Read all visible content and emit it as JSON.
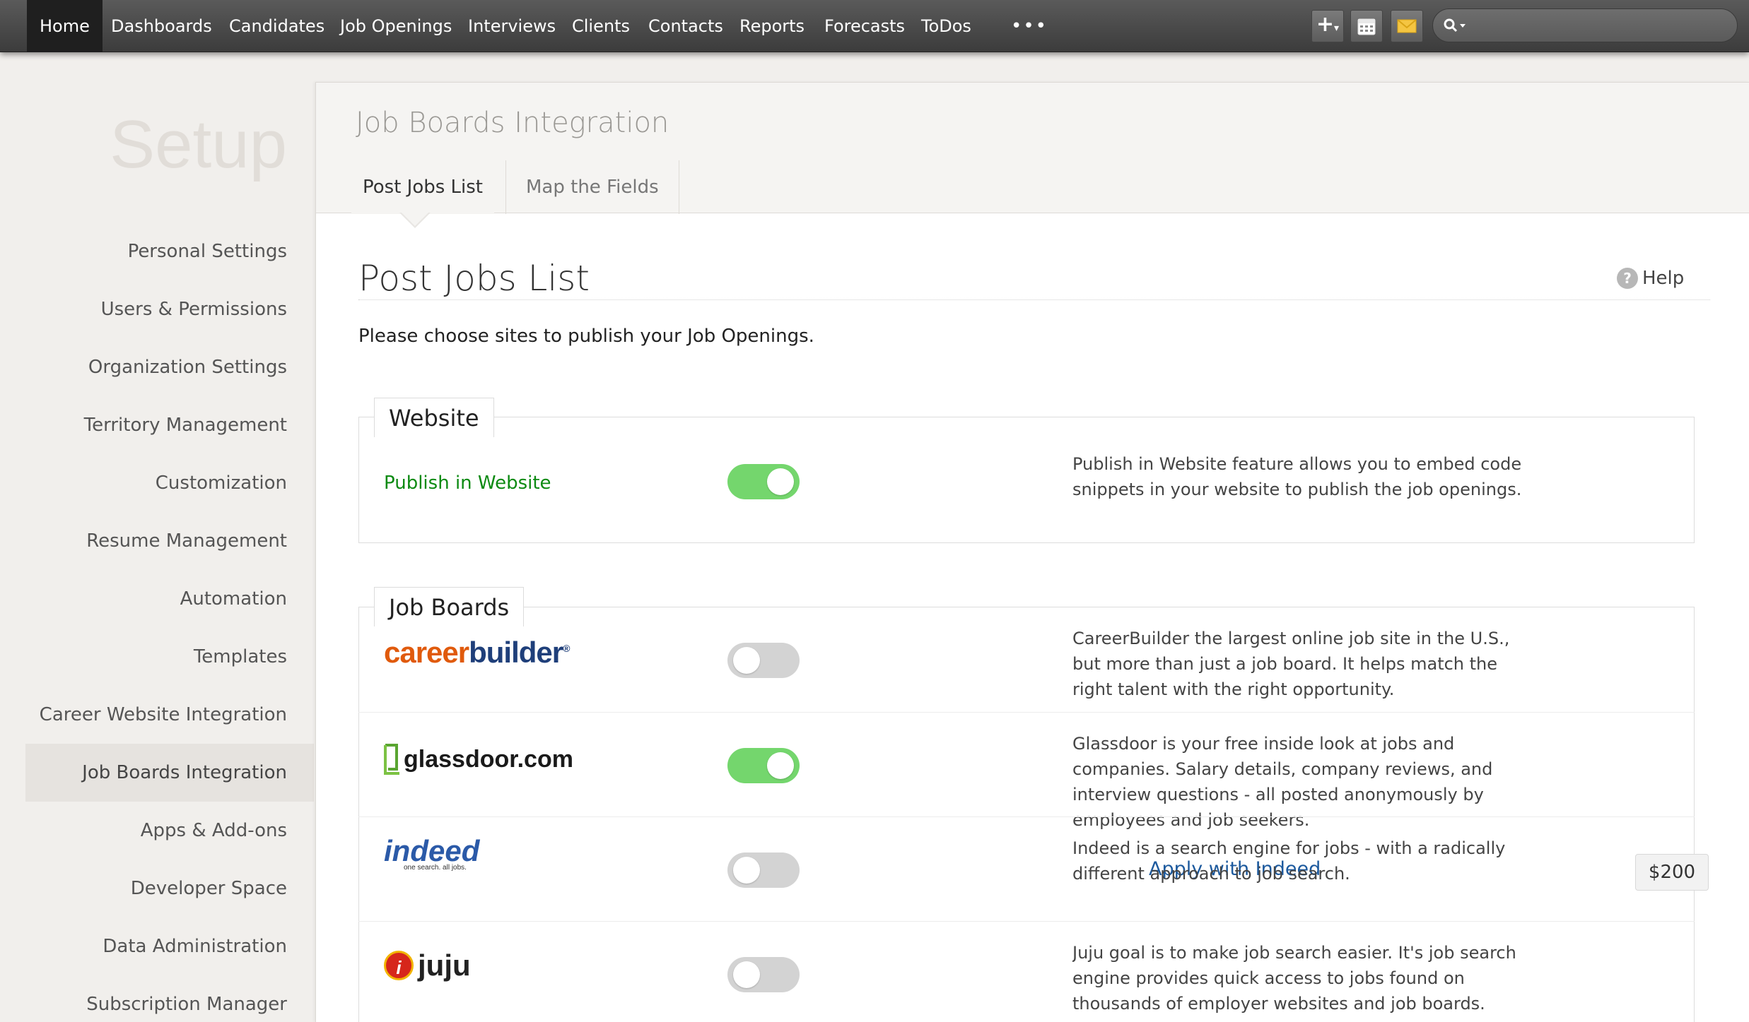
{
  "nav": {
    "items": [
      "Home",
      "Dashboards",
      "Candidates",
      "Job Openings",
      "Interviews",
      "Clients",
      "Contacts",
      "Reports",
      "Forecasts",
      "ToDos"
    ],
    "more": "•••",
    "tools": [
      "add-icon",
      "calendar-icon",
      "mail-icon"
    ],
    "search_icon": "search-icon"
  },
  "sidebar": {
    "title": "Setup",
    "items": [
      {
        "label": "Personal Settings"
      },
      {
        "label": "Users & Permissions"
      },
      {
        "label": "Organization Settings"
      },
      {
        "label": "Territory Management"
      },
      {
        "label": "Customization"
      },
      {
        "label": "Resume Management"
      },
      {
        "label": "Automation"
      },
      {
        "label": "Templates"
      },
      {
        "label": "Career Website Integration"
      },
      {
        "label": "Job Boards Integration"
      },
      {
        "label": "Apps & Add-ons"
      },
      {
        "label": "Developer Space"
      },
      {
        "label": "Data Administration"
      },
      {
        "label": "Subscription Manager"
      }
    ],
    "active_item": "Job Boards Integration"
  },
  "main": {
    "title": "Job Boards Integration",
    "tabs": [
      {
        "label": "Post Jobs List",
        "active": true
      },
      {
        "label": "Map the Fields",
        "active": false
      }
    ],
    "heading": "Post Jobs List",
    "help": "Help",
    "intro": "Please choose sites to publish your Job Openings.",
    "website_section": {
      "label": "Website",
      "rows": [
        {
          "name": "Publish in Website",
          "enabled": true,
          "description": "Publish in Website feature allows you to embed code snippets in your website to publish the job openings."
        }
      ]
    },
    "job_boards_section": {
      "label": "Job Boards",
      "rows": [
        {
          "logo_text": [
            "career",
            "builder",
            "®"
          ],
          "enabled": false,
          "description": "CareerBuilder the largest online job site in the U.S., but more than just a job board. It helps match the right talent with the right opportunity."
        },
        {
          "logo_text": "glassdoor.com",
          "enabled": true,
          "description": "Glassdoor is your free inside look at jobs and companies. Salary details, company reviews, and interview questions - all posted anonymously by employees and job seekers."
        },
        {
          "logo_text": [
            "indeed",
            "one search. all jobs."
          ],
          "enabled": false,
          "link": "Apply with Indeed",
          "price": "$200",
          "description": "Indeed is a search engine for jobs - with a radically different approach to job search."
        },
        {
          "logo_text": [
            "i",
            "juju"
          ],
          "enabled": false,
          "description": "Juju goal is to make job search easier. It's job search engine provides quick access to jobs found on thousands of employer websites and job boards."
        }
      ]
    }
  },
  "colors": {
    "toggle_on": "#74d66d",
    "toggle_off": "#d3d3d3",
    "link_green": "#0c8a12",
    "link_blue": "#1d5a9e"
  }
}
